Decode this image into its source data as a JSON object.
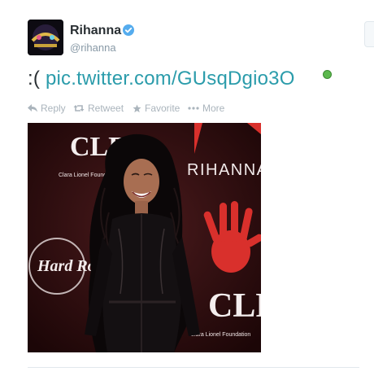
{
  "tweet": {
    "display_name": "Rihanna",
    "handle": "@rihanna",
    "text_prefix": ":(",
    "link_text": "pic.twitter.com/GUsqDgio3O"
  },
  "actions": {
    "reply": "Reply",
    "retweet": "Retweet",
    "favorite": "Favorite",
    "more": "More"
  },
  "photo": {
    "backdrop_logo": "CLF",
    "backdrop_subtext": "Clara Lionel Foundation",
    "backdrop_name": "RIHANNA",
    "backdrop_hardrock": "Hard Rock"
  },
  "colors": {
    "link": "#2b9cab",
    "verified": "#55acee",
    "action_gray": "#aab4bc",
    "backdrop_red": "#d9302c"
  },
  "icons": {
    "verified": "verified-badge-icon",
    "reply": "reply-arrow-icon",
    "retweet": "retweet-icon",
    "favorite": "star-icon",
    "more": "ellipsis-icon",
    "media": "media-attachment-icon"
  }
}
